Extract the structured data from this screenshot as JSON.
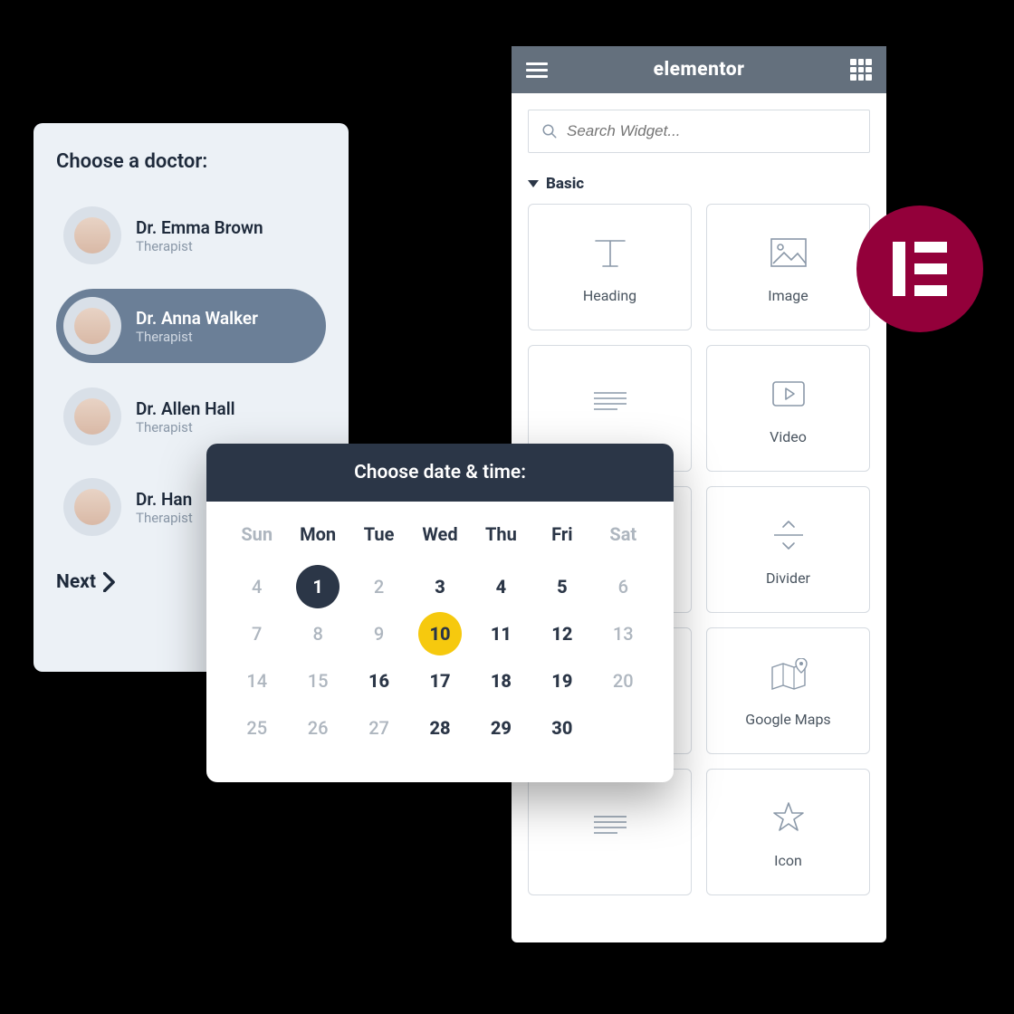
{
  "doctor_panel": {
    "title": "Choose a doctor:",
    "next_label": "Next",
    "doctors": [
      {
        "name": "Dr. Emma Brown",
        "role": "Therapist",
        "selected": false
      },
      {
        "name": "Dr. Anna Walker",
        "role": "Therapist",
        "selected": true
      },
      {
        "name": "Dr. Allen Hall",
        "role": "Therapist",
        "selected": false
      },
      {
        "name": "Dr. Han",
        "role": "Therapist",
        "selected": false
      }
    ]
  },
  "calendar": {
    "title": "Choose date & time:",
    "dow": [
      "Sun",
      "Mon",
      "Tue",
      "Wed",
      "Thu",
      "Fri",
      "Sat"
    ],
    "dow_muted": [
      true,
      false,
      false,
      false,
      false,
      false,
      true
    ],
    "weeks": [
      [
        {
          "d": "4",
          "s": "muted"
        },
        {
          "d": "1",
          "s": "selected"
        },
        {
          "d": "2",
          "s": "muted"
        },
        {
          "d": "3",
          "s": "avail"
        },
        {
          "d": "4",
          "s": "avail"
        },
        {
          "d": "5",
          "s": "avail"
        },
        {
          "d": "6",
          "s": "muted"
        }
      ],
      [
        {
          "d": "7",
          "s": "muted"
        },
        {
          "d": "8",
          "s": "muted"
        },
        {
          "d": "9",
          "s": "muted"
        },
        {
          "d": "10",
          "s": "highlight"
        },
        {
          "d": "11",
          "s": "avail"
        },
        {
          "d": "12",
          "s": "avail"
        },
        {
          "d": "13",
          "s": "muted"
        }
      ],
      [
        {
          "d": "14",
          "s": "muted"
        },
        {
          "d": "15",
          "s": "muted"
        },
        {
          "d": "16",
          "s": "avail"
        },
        {
          "d": "17",
          "s": "avail"
        },
        {
          "d": "18",
          "s": "avail"
        },
        {
          "d": "19",
          "s": "avail"
        },
        {
          "d": "20",
          "s": "muted"
        }
      ],
      [
        {
          "d": "25",
          "s": "muted"
        },
        {
          "d": "26",
          "s": "muted"
        },
        {
          "d": "27",
          "s": "muted"
        },
        {
          "d": "28",
          "s": "avail"
        },
        {
          "d": "29",
          "s": "avail"
        },
        {
          "d": "30",
          "s": "avail"
        },
        {
          "d": "",
          "s": "empty"
        }
      ]
    ]
  },
  "elementor": {
    "brand": "elementor",
    "search_placeholder": "Search Widget...",
    "section": "Basic",
    "widgets": [
      "Heading",
      "Image",
      "",
      "Video",
      "",
      "Divider",
      "",
      "Google Maps",
      "",
      "Icon"
    ]
  }
}
